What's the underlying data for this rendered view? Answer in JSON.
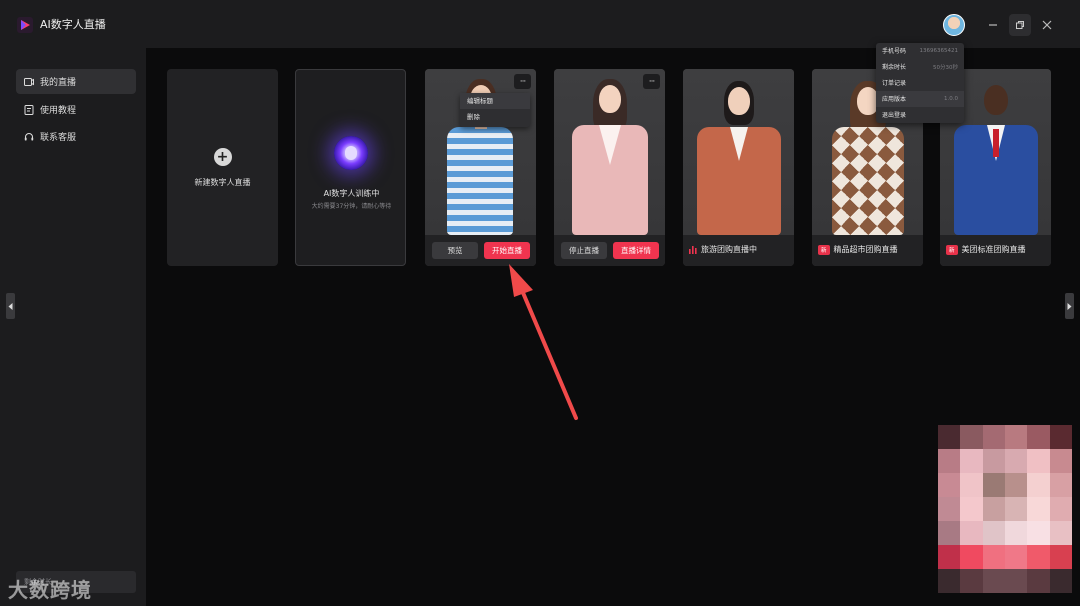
{
  "app": {
    "title": "AI数字人直播"
  },
  "sidebar": {
    "items": [
      {
        "label": "我的直播",
        "icon": "live-icon"
      },
      {
        "label": "使用教程",
        "icon": "tutorial-icon"
      },
      {
        "label": "联系客服",
        "icon": "headset-icon"
      }
    ]
  },
  "cards": {
    "new": {
      "label": "新建数字人直播"
    },
    "training": {
      "title": "AI数字人训练中",
      "subtitle": "大约需要37分钟，请耐心等待"
    },
    "card1": {
      "preview": "预览",
      "start": "开始直播"
    },
    "card2": {
      "stop": "停止直播",
      "details": "直播详情"
    },
    "card3": {
      "status": "旅游团购直播中"
    },
    "card4": {
      "badge": "新",
      "title": "精品超市团购直播"
    },
    "card5": {
      "badge": "新",
      "title": "美团标准团购直播"
    }
  },
  "context_menu": {
    "items": [
      "编辑标题",
      "删除"
    ]
  },
  "user_menu": {
    "phone_label": "手机号码",
    "phone_value": "13696365421",
    "remaining_label": "剩余时长",
    "remaining_value": "50分30秒",
    "orders_label": "订单记录",
    "version_label": "应用版本",
    "version_value": "1.0.0",
    "logout_label": "退出登录"
  },
  "bottom": {
    "remaining": "剩余时长"
  },
  "watermark": "大数跨境",
  "colors": {
    "accent": "#f0344f",
    "background": "#0b0b0c",
    "panel": "#1c1c1e",
    "annotation": "#f04a4a"
  }
}
